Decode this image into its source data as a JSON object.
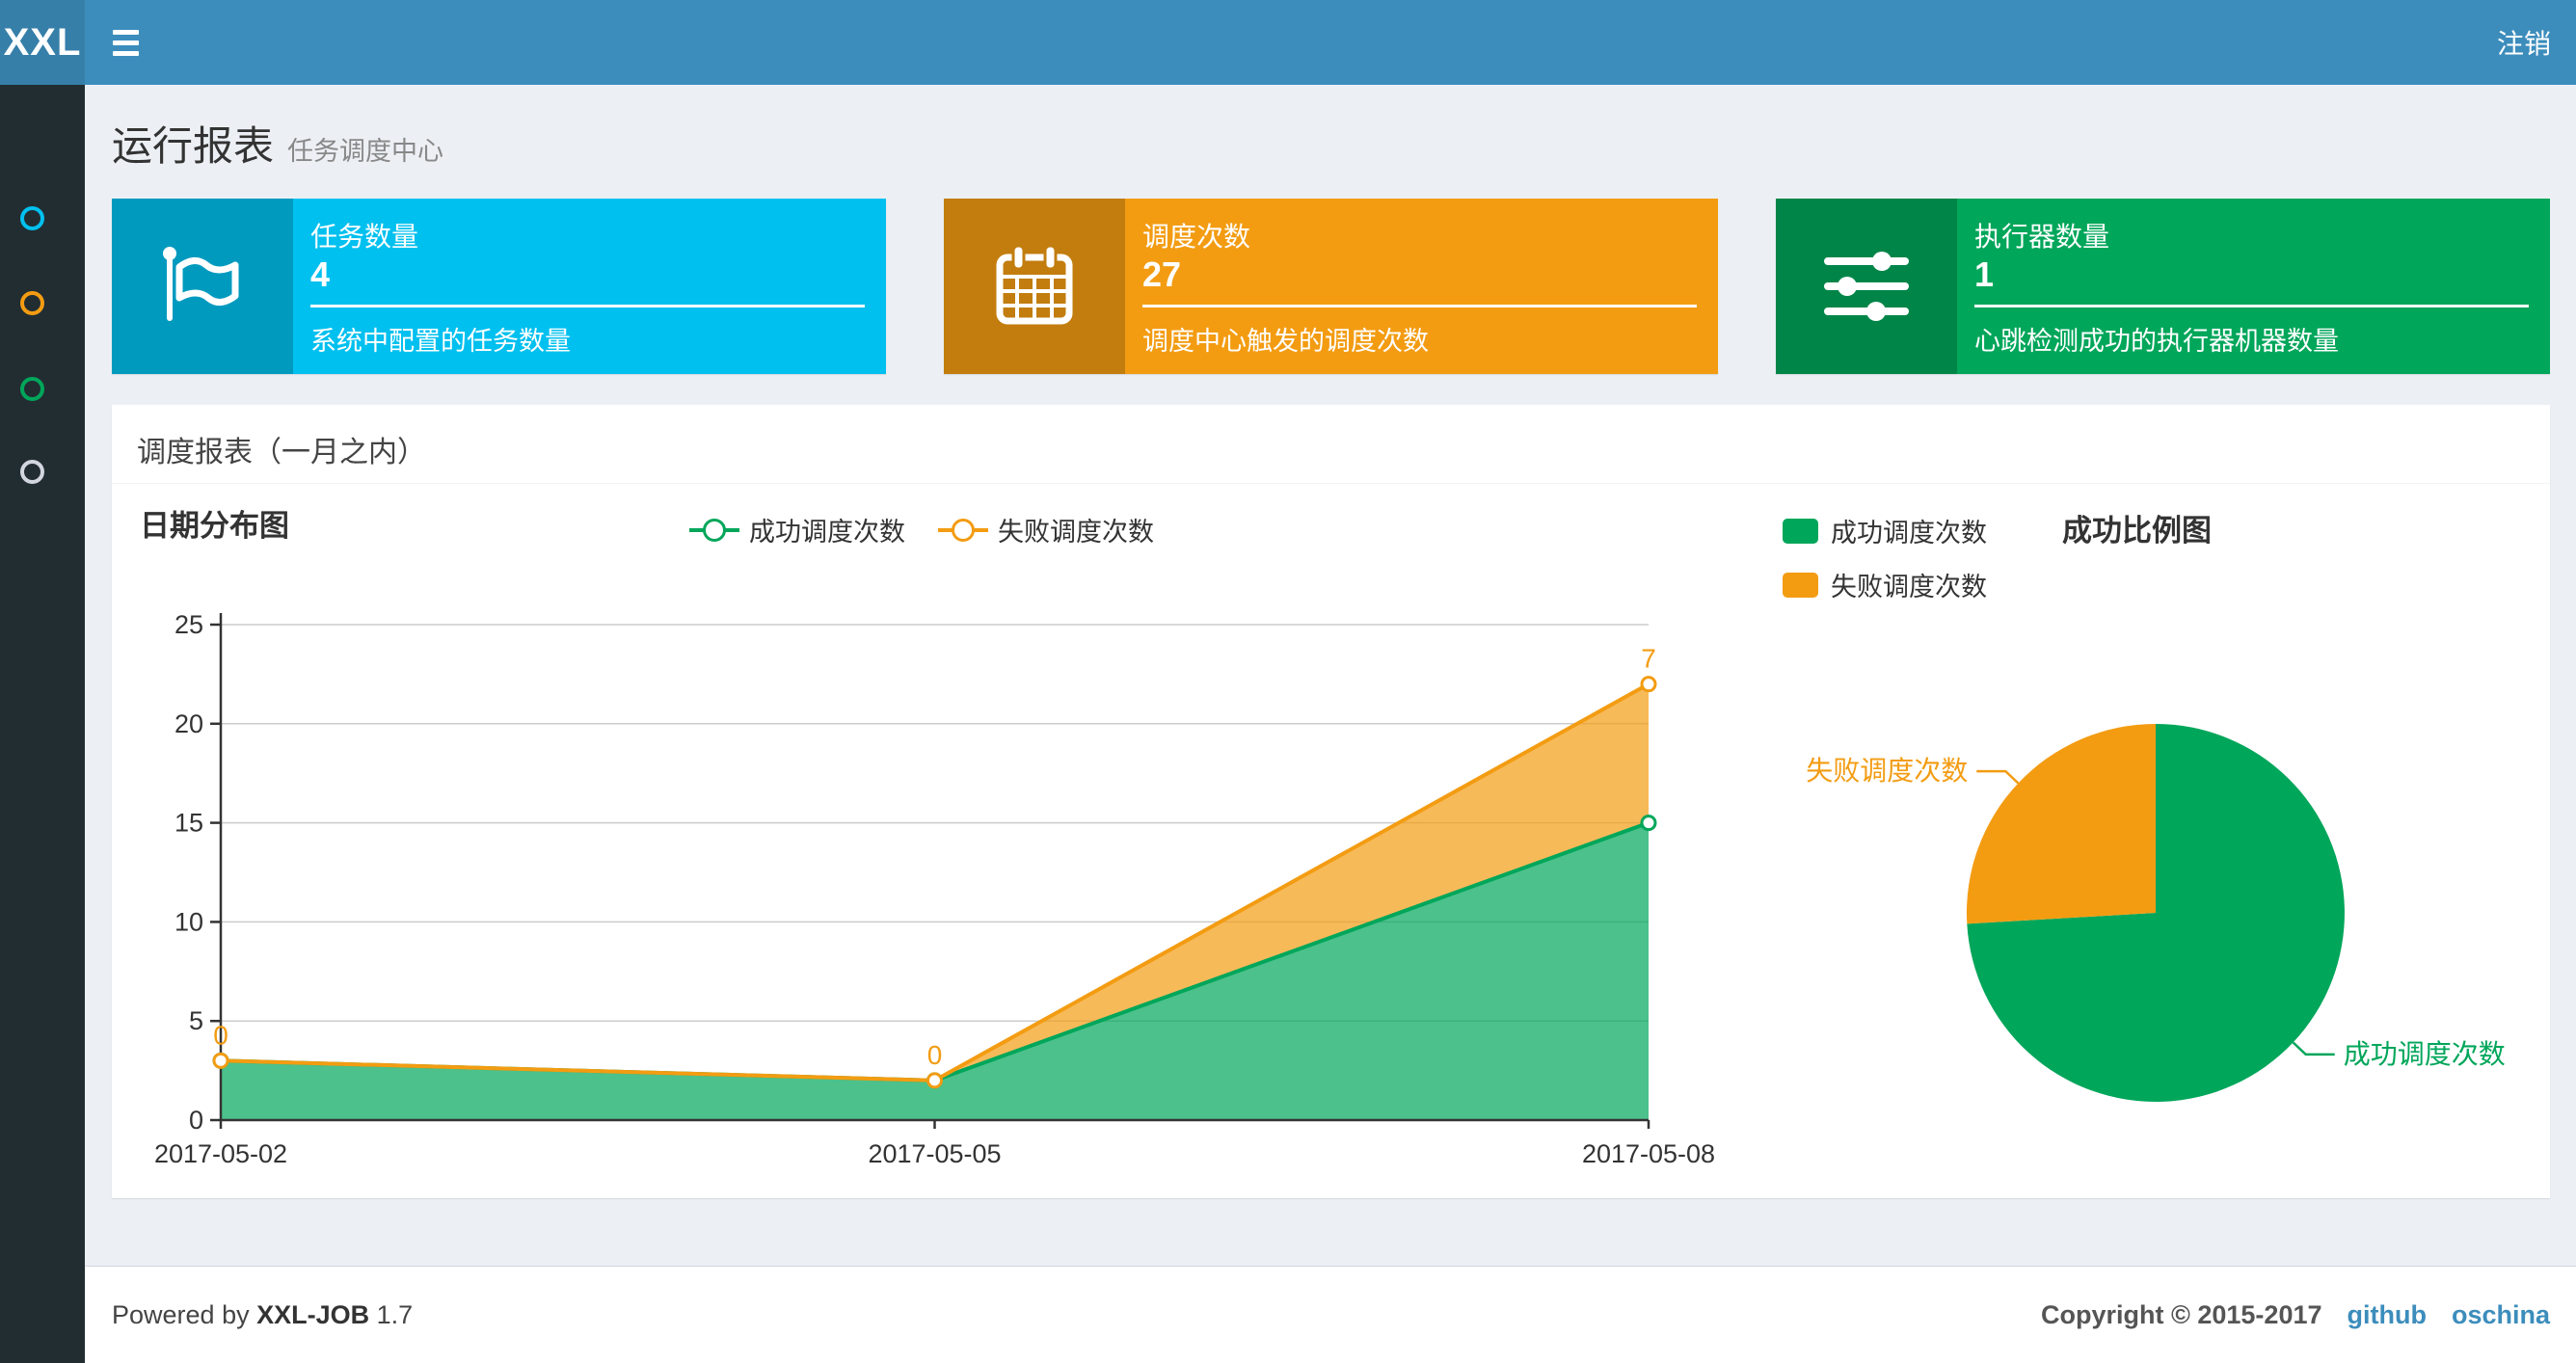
{
  "topbar": {
    "logo": "XXL",
    "logout_label": "注销"
  },
  "colors": {
    "topbar_bg": "#3c8dbc",
    "logo_bg": "#367fa9",
    "sidebar_bg": "#222d32",
    "content_bg": "#ecf0f5",
    "success": "#00a65a",
    "fail": "#f39c12",
    "info": "#00c0ef"
  },
  "sidebar": {
    "icons": [
      {
        "icon": "circle-icon",
        "color": "#00c0ef"
      },
      {
        "icon": "circle-icon",
        "color": "#f39c12"
      },
      {
        "icon": "circle-icon",
        "color": "#00a65a"
      },
      {
        "icon": "circle-icon",
        "color": "#d2d6de"
      }
    ]
  },
  "page_header": {
    "title": "运行报表",
    "subtitle": "任务调度中心"
  },
  "stat_cards": [
    {
      "title": "任务数量",
      "value": "4",
      "description": "系统中配置的任务数量",
      "bg_color": "#00c0ef",
      "icon_bg_color": "#009abf",
      "icon": "flag-icon"
    },
    {
      "title": "调度次数",
      "value": "27",
      "description": "调度中心触发的调度次数",
      "bg_color": "#f39c12",
      "icon_bg_color": "#c27d0e",
      "icon": "calendar-icon"
    },
    {
      "title": "执行器数量",
      "value": "1",
      "description": "心跳检测成功的执行器机器数量",
      "bg_color": "#00a65a",
      "icon_bg_color": "#008548",
      "icon": "sliders-icon"
    }
  ],
  "panel": {
    "title": "调度报表（一月之内）"
  },
  "chart_data": [
    {
      "type": "area",
      "title": "日期分布图",
      "stacked": true,
      "categories": [
        "2017-05-02",
        "2017-05-05",
        "2017-05-08"
      ],
      "series": [
        {
          "name": "成功调度次数",
          "values": [
            3,
            2,
            15
          ],
          "color": "#00a65a"
        },
        {
          "name": "失败调度次数",
          "values": [
            0,
            0,
            7
          ],
          "color": "#f39c12",
          "point_labels": [
            "0",
            "0",
            "7"
          ]
        }
      ],
      "ylim": [
        0,
        25
      ],
      "ytick_interval": 5,
      "grid": true,
      "legend_position": "top-center",
      "area_opacity": 0.7,
      "axis_color": "#333333",
      "grid_color": "#cccccc"
    },
    {
      "type": "pie",
      "title": "成功比例图",
      "labels": [
        "成功调度次数",
        "失败调度次数"
      ],
      "values": [
        20,
        7
      ],
      "colors": [
        "#00a65a",
        "#f39c12"
      ],
      "legend_position": "top-left",
      "start_angle": "top-clockwise"
    }
  ],
  "footer": {
    "powered_by": "Powered by",
    "brand": "XXL-JOB",
    "version": "1.7",
    "copyright": "Copyright © 2015-2017",
    "links": [
      "github",
      "oschina"
    ]
  }
}
